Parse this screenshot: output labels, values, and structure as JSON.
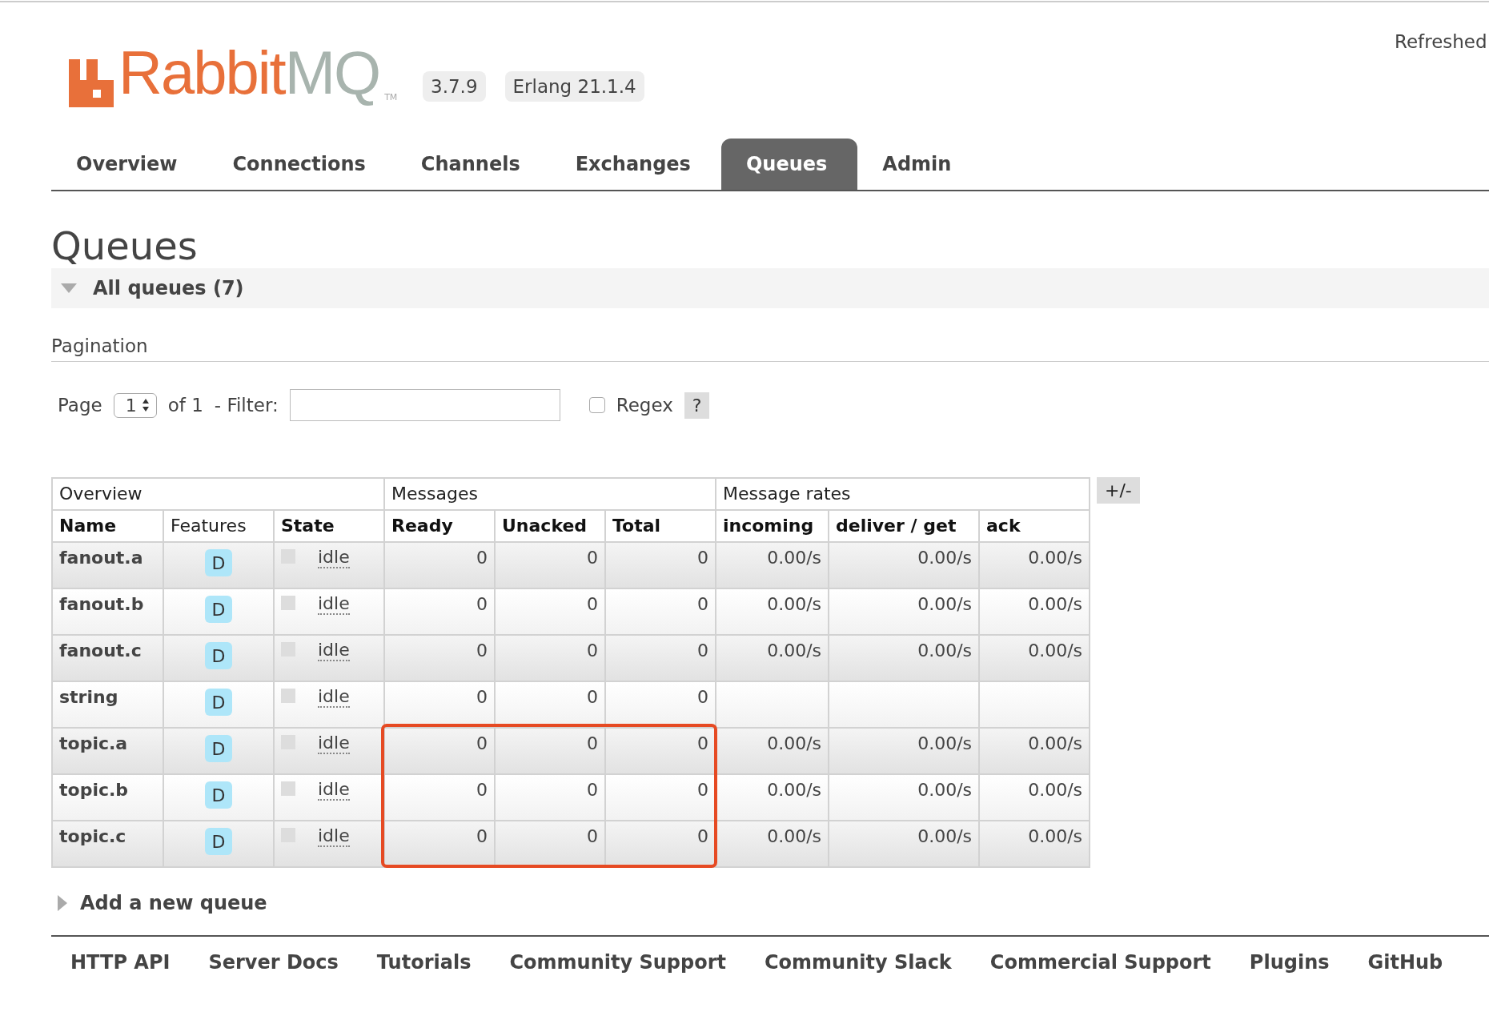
{
  "header": {
    "logo": {
      "name": "Rabbit",
      "suffix": "MQ",
      "mark": "TM"
    },
    "version": "3.7.9",
    "erlang": "Erlang 21.1.4",
    "refreshed": "Refreshed"
  },
  "tabs": [
    {
      "label": "Overview",
      "selected": false
    },
    {
      "label": "Connections",
      "selected": false
    },
    {
      "label": "Channels",
      "selected": false
    },
    {
      "label": "Exchanges",
      "selected": false
    },
    {
      "label": "Queues",
      "selected": true
    },
    {
      "label": "Admin",
      "selected": false
    }
  ],
  "title": "Queues",
  "section": {
    "title": "All queues (7)",
    "expanded": true
  },
  "pagination": {
    "label": "Pagination",
    "page_label": "Page",
    "page": "1",
    "of": "of 1",
    "filter_label": "- Filter:",
    "regex_label": "Regex",
    "regex_checked": false,
    "help": "?"
  },
  "table": {
    "groups": [
      {
        "label": "Overview",
        "columns": [
          {
            "label": "Name",
            "sortable": true
          },
          {
            "label": "Features",
            "sortable": false
          },
          {
            "label": "State",
            "sortable": true
          }
        ]
      },
      {
        "label": "Messages",
        "columns": [
          {
            "label": "Ready",
            "sortable": true
          },
          {
            "label": "Unacked",
            "sortable": true
          },
          {
            "label": "Total",
            "sortable": true
          }
        ]
      },
      {
        "label": "Message rates",
        "columns": [
          {
            "label": "incoming",
            "sortable": true
          },
          {
            "label": "deliver / get",
            "sortable": true
          },
          {
            "label": "ack",
            "sortable": true
          }
        ]
      }
    ],
    "toggle": "+/-",
    "rows": [
      {
        "name": "fanout.a",
        "features": "D",
        "state": "idle",
        "ready": "0",
        "unacked": "0",
        "total": "0",
        "incoming": "0.00/s",
        "deliver_get": "0.00/s",
        "ack": "0.00/s",
        "highlighted": false
      },
      {
        "name": "fanout.b",
        "features": "D",
        "state": "idle",
        "ready": "0",
        "unacked": "0",
        "total": "0",
        "incoming": "0.00/s",
        "deliver_get": "0.00/s",
        "ack": "0.00/s",
        "highlighted": false
      },
      {
        "name": "fanout.c",
        "features": "D",
        "state": "idle",
        "ready": "0",
        "unacked": "0",
        "total": "0",
        "incoming": "0.00/s",
        "deliver_get": "0.00/s",
        "ack": "0.00/s",
        "highlighted": false
      },
      {
        "name": "string",
        "features": "D",
        "state": "idle",
        "ready": "0",
        "unacked": "0",
        "total": "0",
        "highlighted": false
      },
      {
        "name": "topic.a",
        "features": "D",
        "state": "idle",
        "ready": "0",
        "unacked": "0",
        "total": "0",
        "incoming": "0.00/s",
        "deliver_get": "0.00/s",
        "ack": "0.00/s",
        "highlighted": true
      },
      {
        "name": "topic.b",
        "features": "D",
        "state": "idle",
        "ready": "0",
        "unacked": "0",
        "total": "0",
        "incoming": "0.00/s",
        "deliver_get": "0.00/s",
        "ack": "0.00/s",
        "highlighted": true
      },
      {
        "name": "topic.c",
        "features": "D",
        "state": "idle",
        "ready": "0",
        "unacked": "0",
        "total": "0",
        "incoming": "0.00/s",
        "deliver_get": "0.00/s",
        "ack": "0.00/s",
        "highlighted": true
      }
    ]
  },
  "add_queue": {
    "title": "Add a new queue",
    "expanded": false
  },
  "footer": [
    "HTTP API",
    "Server Docs",
    "Tutorials",
    "Community Support",
    "Community Slack",
    "Commercial Support",
    "Plugins",
    "GitHub"
  ]
}
